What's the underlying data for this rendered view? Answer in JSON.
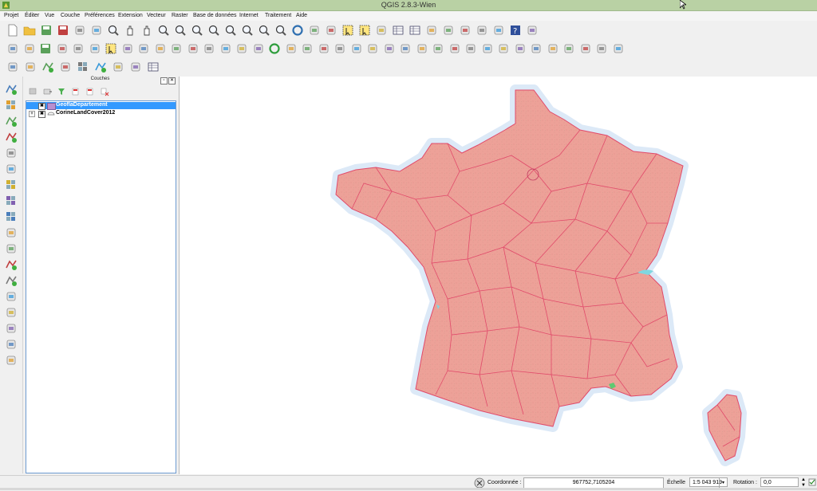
{
  "window": {
    "title": "QGIS 2.8.3-Wien"
  },
  "menu": [
    "Projet",
    "Éditer",
    "Vue",
    "Couche",
    "Préférences",
    "Extension",
    "Vecteur",
    "Raster",
    "Base de données",
    "Internet",
    "Traitement",
    "Aide"
  ],
  "panel": {
    "title": "Couches"
  },
  "layers": [
    {
      "name": "GeoflaDepartement",
      "checked": "✖",
      "selected": true
    },
    {
      "name": "CorineLandCover2012",
      "checked": "✖",
      "selected": false
    }
  ],
  "status": {
    "coord_label": "Coordonnée :",
    "coord_value": "967752,7105204",
    "scale_label": "Échelle",
    "scale_value": "1:5 043 919",
    "rotation_label": "Rotation :",
    "rotation_value": "0,0"
  },
  "colors": {
    "titlebar": "#b9d1a4",
    "selection": "#3399ff",
    "map_fill": "#eda198",
    "map_border": "#e14a6a",
    "sea_halo": "#dce9f7"
  },
  "icons": {
    "toolbar1": [
      "new-project-icon",
      "open-project-icon",
      "save-project-icon",
      "save-as-icon",
      "new-print-composer-icon",
      "composer-manager-icon",
      "touch-zoom-icon",
      "pan-icon",
      "pan-to-selection-icon",
      "zoom-in-icon",
      "zoom-out-icon",
      "zoom-actual-icon",
      "zoom-full-icon",
      "zoom-to-selection-icon",
      "zoom-to-layer-icon",
      "zoom-last-icon",
      "zoom-next-icon",
      "refresh-icon",
      "identify-icon",
      "action-icon",
      "select-features-icon",
      "deselect-icon",
      "field-calculator-icon",
      "attribute-table-icon",
      "statistics-icon",
      "measure-icon",
      "map-tips-icon",
      "new-bookmark-icon",
      "show-bookmarks-icon",
      "text-annotation-icon",
      "help-icon",
      "whats-this-icon"
    ],
    "toolbar2": [
      "current-edits-icon",
      "toggle-editing-icon",
      "save-edits-icon",
      "add-feature-icon",
      "move-feature-icon",
      "node-tool-icon",
      "delete-selected-icon",
      "cut-features-icon",
      "copy-features-icon",
      "paste-features-icon",
      "label-icon",
      "pin-labels-icon",
      "show-labels-icon",
      "move-label-icon",
      "rotate-label-icon",
      "change-label-icon",
      "globe-icon",
      "python-console-icon",
      "plugin-icon",
      "grass-icon",
      "svg-icon",
      "advanced-digitize-icon",
      "undo-icon",
      "redo-icon",
      "rotate-feature-icon",
      "simplify-icon",
      "add-ring-icon",
      "add-part-icon",
      "fill-ring-icon",
      "delete-ring-icon",
      "delete-part-icon",
      "reshape-icon",
      "offset-curve-icon",
      "split-features-icon",
      "split-parts-icon",
      "merge-features-icon",
      "merge-attributes-icon",
      "rotate-point-icon"
    ],
    "toolbar3": [
      "new-layer-icon",
      "db-manager-icon",
      "shapefile-icon",
      "georeferencer-icon",
      "raster-tools-icon",
      "vector-tools-icon",
      "gps-icon",
      "layer-props-icon",
      "table-icon"
    ],
    "left": [
      "add-vector-layer-icon",
      "add-raster-layer-icon",
      "add-postgis-layer-icon",
      "add-spatialite-layer-icon",
      "add-mssql-layer-icon",
      "add-oracle-layer-icon",
      "add-wms-layer-icon",
      "add-wcs-layer-icon",
      "add-wfs-layer-icon",
      "add-delimited-text-icon",
      "add-virtual-layer-icon",
      "new-shapefile-icon",
      "new-temp-layer-icon",
      "coordinate-capture-icon",
      "add-feature-point-icon",
      "vertex-tool-icon",
      "node-editor-icon",
      "georeferencer-icon"
    ]
  }
}
